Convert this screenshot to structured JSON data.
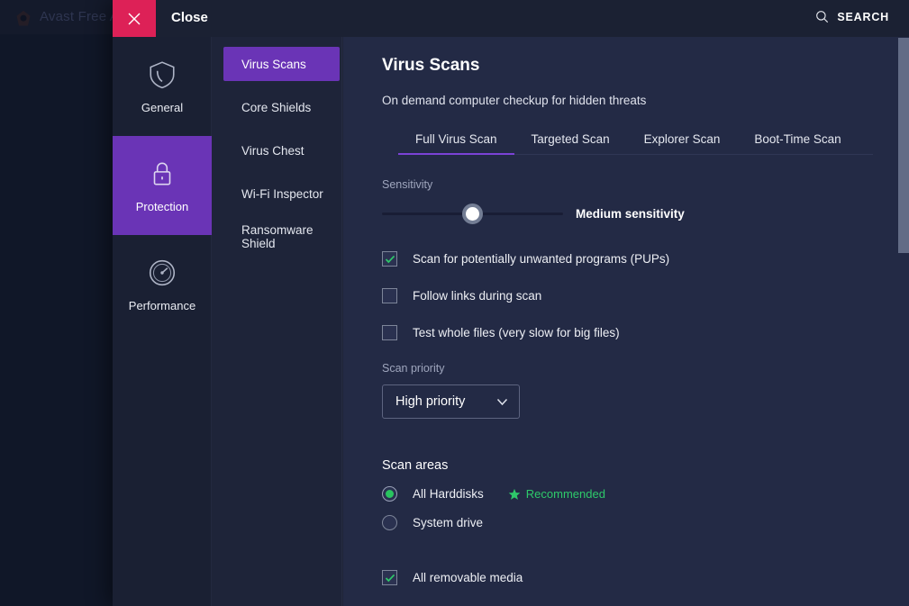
{
  "background_window": {
    "app_title": "Avast Free A",
    "logo_icon": "avast-logo-icon"
  },
  "topbar": {
    "close_icon": "close-icon",
    "close_label": "Close",
    "search_icon": "search-icon",
    "search_label": "SEARCH"
  },
  "rail": {
    "items": [
      {
        "label": "General",
        "icon": "shield-icon",
        "active": false
      },
      {
        "label": "Protection",
        "icon": "lock-icon",
        "active": true
      },
      {
        "label": "Performance",
        "icon": "gauge-icon",
        "active": false
      }
    ]
  },
  "subnav": {
    "items": [
      {
        "label": "Virus Scans",
        "active": true
      },
      {
        "label": "Core Shields",
        "active": false
      },
      {
        "label": "Virus Chest",
        "active": false
      },
      {
        "label": "Wi-Fi Inspector",
        "active": false
      },
      {
        "label": "Ransomware Shield",
        "active": false
      }
    ]
  },
  "main": {
    "title": "Virus Scans",
    "subtitle": "On demand computer checkup for hidden threats",
    "tabs": [
      {
        "label": "Full Virus Scan",
        "active": true
      },
      {
        "label": "Targeted Scan",
        "active": false
      },
      {
        "label": "Explorer Scan",
        "active": false
      },
      {
        "label": "Boot-Time Scan",
        "active": false
      }
    ],
    "sensitivity": {
      "label": "Sensitivity",
      "value_label": "Medium sensitivity",
      "percent": 50
    },
    "options": [
      {
        "label": "Scan for potentially unwanted programs (PUPs)",
        "checked": true
      },
      {
        "label": "Follow links during scan",
        "checked": false
      },
      {
        "label": "Test whole files (very slow for big files)",
        "checked": false
      }
    ],
    "scan_priority": {
      "label": "Scan priority",
      "value": "High priority",
      "chevron_icon": "chevron-down-icon"
    },
    "scan_areas": {
      "heading": "Scan areas",
      "radios": [
        {
          "label": "All Harddisks",
          "selected": true,
          "badge": "Recommended",
          "badge_icon": "star-icon"
        },
        {
          "label": "System drive",
          "selected": false,
          "badge": null
        }
      ],
      "removable": {
        "label": "All removable media",
        "checked": true
      }
    }
  },
  "colors": {
    "accent_purple": "#6a34b6",
    "tab_underline": "#7b42d6",
    "close_red": "#dd2157",
    "success_green": "#2ec96a",
    "panel_bg": "#232a45"
  }
}
